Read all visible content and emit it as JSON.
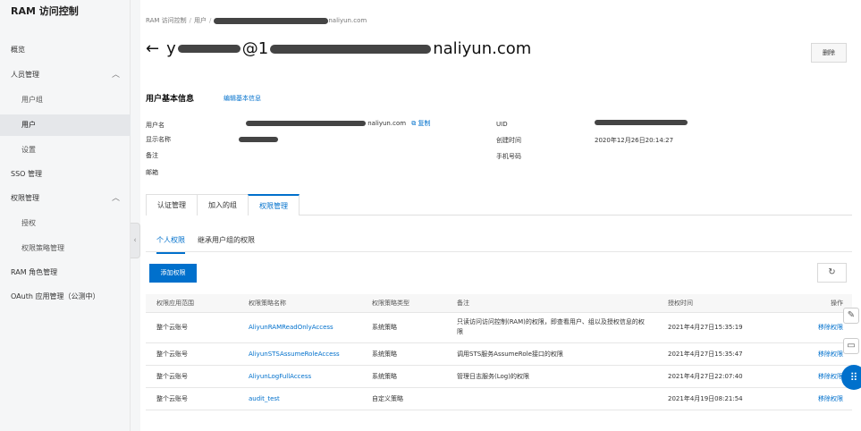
{
  "sidebar": {
    "title": "RAM 访问控制",
    "items": [
      {
        "label": "概览"
      },
      {
        "label": "人员管理"
      },
      {
        "label": "用户组"
      },
      {
        "label": "用户"
      },
      {
        "label": "设置"
      },
      {
        "label": "SSO 管理"
      },
      {
        "label": "权限管理"
      },
      {
        "label": "授权"
      },
      {
        "label": "权限策略管理"
      },
      {
        "label": "RAM 角色管理"
      },
      {
        "label": "OAuth 应用管理（公测中）"
      }
    ],
    "collapse_glyph": "‹",
    "chevron_glyph": "︿"
  },
  "breadcrumb": {
    "root": "RAM 访问控制",
    "sep": "/",
    "users": "用户",
    "tail": "naliyun.com"
  },
  "header": {
    "back_glyph": "←",
    "name_start": "y",
    "name_mid": "@1",
    "name_end": "naliyun.com",
    "delete_label": "删除"
  },
  "basic_info": {
    "title": "用户基本信息",
    "edit_label": "编辑基本信息",
    "username_label": "用户名",
    "username_tail": "naliyun.com",
    "copy_label": "⧉ 复制",
    "display_name_label": "显示名称",
    "remark_label": "备注",
    "email_label": "邮箱",
    "uid_label": "UID",
    "created_label": "创建时间",
    "created_value": "2020年12月26日20:14:27",
    "phone_label": "手机号码"
  },
  "tabs": [
    {
      "label": "认证管理"
    },
    {
      "label": "加入的组"
    },
    {
      "label": "权限管理"
    }
  ],
  "subtabs": [
    {
      "label": "个人权限"
    },
    {
      "label": "继承用户组的权限"
    }
  ],
  "toolbar": {
    "add_label": "添加权限",
    "refresh_glyph": "↻"
  },
  "table": {
    "headers": [
      "权限应用范围",
      "权限策略名称",
      "权限策略类型",
      "备注",
      "授权时间",
      "操作"
    ],
    "rows": [
      {
        "scope": "整个云账号",
        "policy": "AliyunRAMReadOnlyAccess",
        "type": "系统策略",
        "note": "只读访问访问控制(RAM)的权限，即查看用户、组以及授权信息的权限",
        "time": "2021年4月27日15:35:19",
        "action": "移除权限"
      },
      {
        "scope": "整个云账号",
        "policy": "AliyunSTSAssumeRoleAccess",
        "type": "系统策略",
        "note": "调用STS服务AssumeRole接口的权限",
        "time": "2021年4月27日15:35:47",
        "action": "移除权限"
      },
      {
        "scope": "整个云账号",
        "policy": "AliyunLogFullAccess",
        "type": "系统策略",
        "note": "管理日志服务(Log)的权限",
        "time": "2021年4月27日22:07:40",
        "action": "移除权限"
      },
      {
        "scope": "整个云账号",
        "policy": "audit_test",
        "type": "自定义策略",
        "note": "",
        "time": "2021年4月19日08:21:54",
        "action": "移除权限"
      }
    ]
  },
  "float_widgets": {
    "feedback_glyph": "✎",
    "chat_glyph": "▭",
    "apps_glyph": "⠿"
  }
}
